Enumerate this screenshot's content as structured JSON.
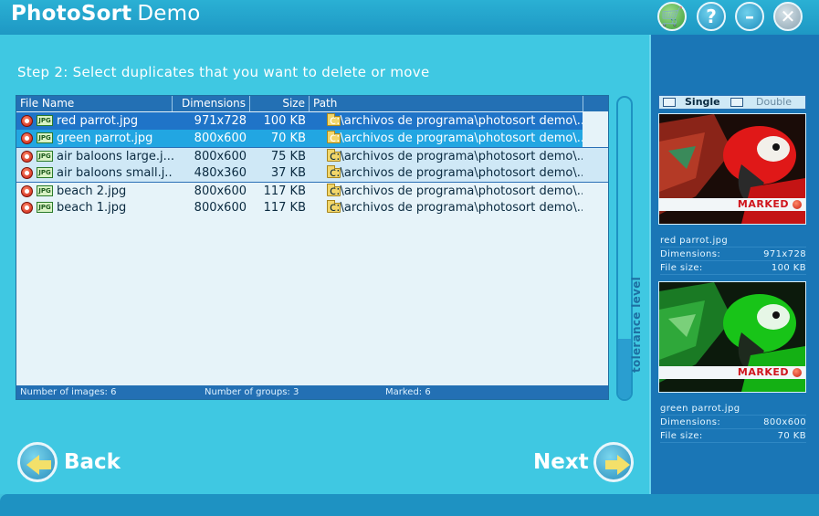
{
  "app": {
    "name": "PhotoSort",
    "edition": "Demo"
  },
  "titlebar_buttons": [
    {
      "name": "cart-icon",
      "glyph": "🛒"
    },
    {
      "name": "help-icon",
      "glyph": "?"
    },
    {
      "name": "minimize-icon",
      "glyph": "–"
    },
    {
      "name": "close-icon",
      "glyph": "✕"
    }
  ],
  "step_title": "Step 2:  Select duplicates that you want to delete or move",
  "list": {
    "columns": [
      "File Name",
      "Dimensions",
      "Size",
      "Path"
    ],
    "rows": [
      {
        "name": "red parrot.jpg",
        "dimensions": "971x728",
        "size": "100 KB",
        "path": "c:\\archivos de programa\\photosort demo\\..."
      },
      {
        "name": "green parrot.jpg",
        "dimensions": "800x600",
        "size": "70 KB",
        "path": "c:\\archivos de programa\\photosort demo\\..."
      },
      {
        "name": "air baloons large.j...",
        "dimensions": "800x600",
        "size": "75 KB",
        "path": "c:\\archivos de programa\\photosort demo\\..."
      },
      {
        "name": "air baloons small.j...",
        "dimensions": "480x360",
        "size": "37 KB",
        "path": "c:\\archivos de programa\\photosort demo\\..."
      },
      {
        "name": "beach 2.jpg",
        "dimensions": "800x600",
        "size": "117 KB",
        "path": "c:\\archivos de programa\\photosort demo\\..."
      },
      {
        "name": "beach 1.jpg",
        "dimensions": "800x600",
        "size": "117 KB",
        "path": "c:\\archivos de programa\\photosort demo\\..."
      }
    ],
    "badge": "JPG",
    "status": {
      "images": "Number of images: 6",
      "groups": "Number of groups: 3",
      "marked": "Marked:  6"
    }
  },
  "tolerance": {
    "label": "tolerance level",
    "level": 0.2
  },
  "nav": {
    "back": "Back",
    "next": "Next"
  },
  "right_panel": {
    "view_single": "Single",
    "view_double": "Double",
    "marked_label": "MARKED",
    "images": [
      {
        "name": "red parrot.jpg",
        "dim_label": "Dimensions:",
        "dim": "971x728",
        "size_label": "File size:",
        "size": "100 KB"
      },
      {
        "name": "green parrot.jpg",
        "dim_label": "Dimensions:",
        "dim": "800x600",
        "size_label": "File size:",
        "size": "70 KB"
      }
    ]
  },
  "colors": {
    "accent": "#3fc8e2",
    "header": "#2370b4",
    "marked": "#d0141c"
  }
}
